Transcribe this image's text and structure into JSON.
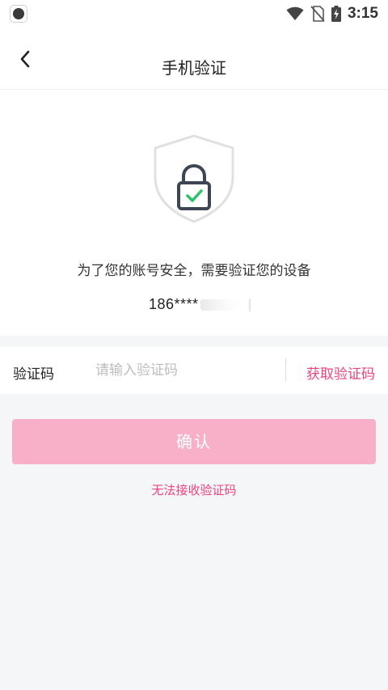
{
  "status_bar": {
    "time": "3:15",
    "icons": [
      "wifi-icon",
      "no-sim-icon",
      "battery-charging-icon"
    ]
  },
  "nav": {
    "back_icon": "chevron-left-icon",
    "title": "手机验证"
  },
  "hero": {
    "icon": "shield-lock-icon",
    "hint": "为了您的账号安全，需要验证您的设备",
    "phone": "186****"
  },
  "verify": {
    "label": "验证码",
    "placeholder": "请输入验证码",
    "value": "",
    "get_code": "获取验证码"
  },
  "actions": {
    "confirm": "确认",
    "no_code": "无法接收验证码"
  },
  "colors": {
    "accent": "#f0437d",
    "confirm_disabled": "#f8b0c8",
    "check": "#2bc36a",
    "page_bg": "#f5f6f8"
  }
}
